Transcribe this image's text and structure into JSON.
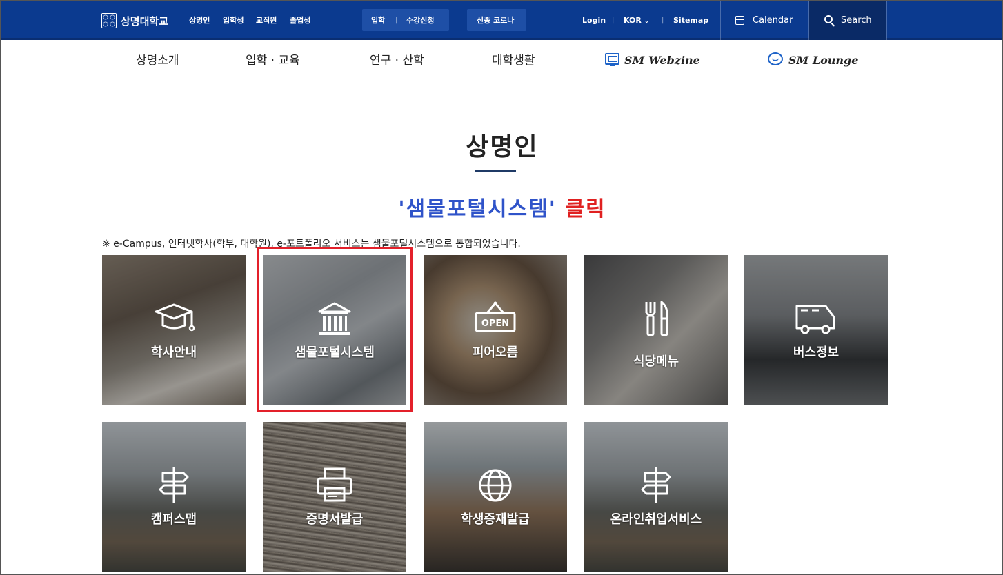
{
  "topbar": {
    "logo_text": "상명대학교",
    "quick_links": [
      "상명인",
      "입학생",
      "교직원",
      "졸업생"
    ],
    "admission_links": [
      "입학",
      "수강신청"
    ],
    "covid_link": "신종 코로나",
    "login": "Login",
    "language": "KOR",
    "sitemap": "Sitemap",
    "calendar": "Calendar",
    "search": "Search",
    "separator": "|"
  },
  "mainnav": {
    "items": [
      "상명소개",
      "입학 · 교육",
      "연구 · 산학",
      "대학생활"
    ],
    "webzine": "SM Webzine",
    "lounge": "SM Lounge"
  },
  "content": {
    "title": "상명인",
    "annotation_quoted": "'샘물포털시스템'",
    "annotation_action": "클릭",
    "notice": "※ e-Campus, 인터넷학사(학부, 대학원), e-포트폴리오 서비스는 샘물포털시스템으로 통합되었습니다."
  },
  "tiles": [
    {
      "label": "학사안내",
      "icon": "graduation-cap-icon"
    },
    {
      "label": "샘물포털시스템",
      "icon": "institution-icon"
    },
    {
      "label": "피어오름",
      "icon": "open-sign-icon",
      "icon_text": "OPEN"
    },
    {
      "label": "식당메뉴",
      "icon": "fork-knife-icon"
    },
    {
      "label": "버스정보",
      "icon": "bus-icon"
    },
    {
      "label": "캠퍼스맵",
      "icon": "signpost-icon"
    },
    {
      "label": "증명서발급",
      "icon": "printer-icon"
    },
    {
      "label": "학생증재발급",
      "icon": "globe-icon"
    },
    {
      "label": "온라인취업서비스",
      "icon": "signpost-icon"
    }
  ],
  "colors": {
    "topbar": "#0b3a8f",
    "annotation_blue": "#2f53c9",
    "annotation_red": "#e02020",
    "highlight_border": "#e3202a"
  }
}
